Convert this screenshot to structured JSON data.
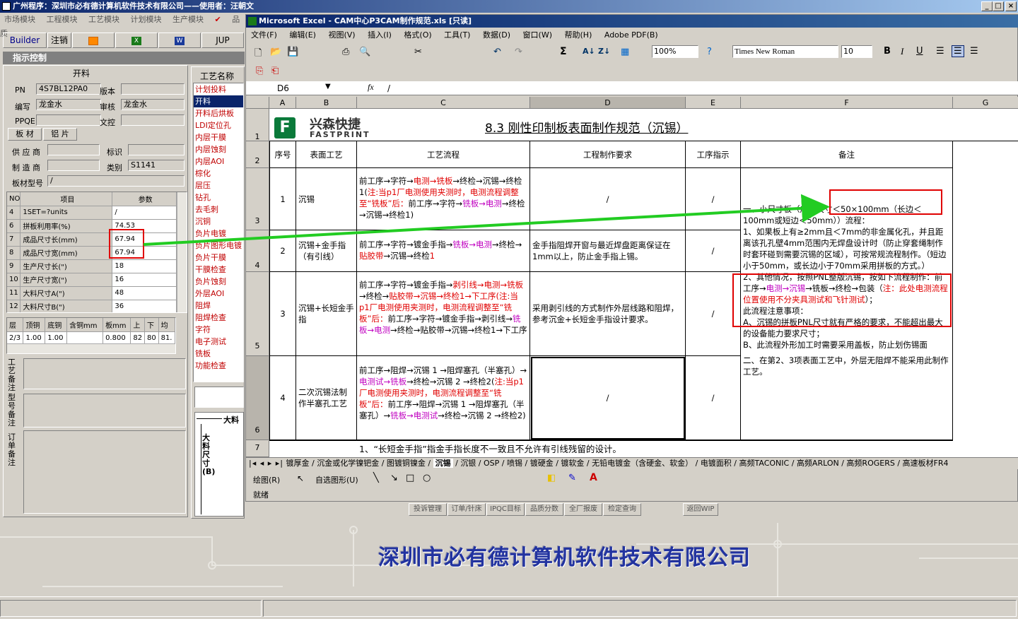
{
  "app": {
    "title": "广州程序：深圳市必有德计算机软件技术有限公司——使用者：汪朝文",
    "menu": [
      "市场模块",
      "工程模块",
      "工艺模块",
      "计划模块",
      "生产模块",
      "品质"
    ],
    "toolbar": {
      "builder": "Builder",
      "cancel": "注销",
      "jup": "JUP"
    },
    "panel_title": "指示控制",
    "group_title": "开料",
    "pn_label": "PN",
    "pn_value": "4S7BL12PA0",
    "version_label": "版本",
    "editor_label": "编写",
    "editor_value": "龙金水",
    "reviewer_label": "审核",
    "reviewer_value": "龙金水",
    "ppqe_label": "PPQE",
    "control_label": "文控",
    "tab_sheet": "板 材",
    "tab_copper": "铝 片",
    "supplier_label": "供 应 商",
    "mark_label": "标识",
    "maker_label": "制 造 商",
    "category_label": "类别",
    "category_value": "S1141",
    "model_label": "板材型号",
    "model_value": "/",
    "grid_head": [
      "NO",
      "项目",
      "参数"
    ],
    "grid_rows": [
      [
        "4",
        "1SET=?units",
        "/"
      ],
      [
        "6",
        "拼板利用率(%)",
        "74.53"
      ],
      [
        "7",
        "成品尺寸长(mm)",
        "67.94"
      ],
      [
        "8",
        "成品尺寸宽(mm)",
        "67.94"
      ],
      [
        "9",
        "生产尺寸长(\")",
        "18"
      ],
      [
        "10",
        "生产尺寸宽(\")",
        "16"
      ],
      [
        "11",
        "大料尺寸A(\")",
        "48"
      ],
      [
        "12",
        "大料尺寸B(\")",
        "36"
      ]
    ],
    "layer_head": [
      "层",
      "顶铜",
      "底铜",
      "含铜mm",
      "板mm",
      "上",
      "下",
      "均"
    ],
    "layer_row": [
      "2/3",
      "1.00",
      "1.00",
      "",
      "0.800",
      "82",
      "80",
      "81."
    ],
    "note_labels": [
      "工艺备注",
      "型号备注",
      "订单备注"
    ],
    "process_title": "工艺名称",
    "process_list": [
      "计划投料",
      "开料",
      "开料后烘板",
      "LDI定位孔",
      "内层干膜",
      "内层蚀刻",
      "内层AOI",
      "棕化",
      "层压",
      "钻孔",
      "去毛刺",
      "沉铜",
      "负片电镀",
      "负片图形电镀",
      "负片干膜",
      "干膜检查",
      "负片蚀刻",
      "外层AOI",
      "阻焊",
      "阻焊检查",
      "字符",
      "电子测试",
      "铣板",
      "功能检查"
    ],
    "dim_big": "大料",
    "dim_size": "大料尺寸(B)",
    "bottom_btns": [
      "投诉管理",
      "订单/针床",
      "IPQC目标",
      "品质分数",
      "全厂报废",
      "检定查询",
      "返回WIP"
    ],
    "footer": "深圳市必有德计算机软件技术有限公司"
  },
  "excel": {
    "title": "Microsoft Excel - CAM中心P3CAM制作规范.xls [只读]",
    "menu": [
      "文件(F)",
      "编辑(E)",
      "视图(V)",
      "插入(I)",
      "格式(O)",
      "工具(T)",
      "数据(D)",
      "窗口(W)",
      "帮助(H)",
      "Adobe PDF(B)"
    ],
    "zoom": "100%",
    "font": "Times New Roman",
    "font_size": "10",
    "name_box": "D6",
    "formula": "/",
    "columns": [
      "A",
      "B",
      "C",
      "D",
      "E",
      "F",
      "G"
    ],
    "logo_cn": "兴森快捷",
    "logo_en": "FASTPRINT",
    "doc_title": "8.3 刚性印制板表面制作规范（沉锡）",
    "headers": [
      "序号",
      "表面工艺",
      "工艺流程",
      "工程制作要求",
      "工序指示",
      "备注"
    ],
    "rows": [
      {
        "no": "1",
        "process": "沉锡",
        "req": "/",
        "step": "/"
      },
      {
        "no": "2",
        "process": "沉锡+金手指（有引线）",
        "req": "金手指阻焊开窗与最近焊盘距离保证在1mm以上，防止金手指上锡。",
        "step": "/"
      },
      {
        "no": "3",
        "process": "沉锡+长短金手指",
        "req": "采用剥引线的方式制作外层线路和阻焊，参考沉金+长短金手指设计要求。",
        "step": "/"
      },
      {
        "no": "4",
        "process": "二次沉锡法制作半塞孔工艺",
        "req": "/",
        "step": "/"
      }
    ],
    "flow1": [
      [
        "前工序→字符→",
        "k"
      ],
      [
        "电测→铣板",
        "r"
      ],
      [
        "→终检→沉锡→终检1(",
        "k"
      ],
      [
        "注:当p1厂电测使用夹测时，电测流程调整至“铣板”后：",
        "r"
      ],
      [
        "前工序→字符→",
        "k"
      ],
      [
        "铣板→电测",
        "m"
      ],
      [
        "→终检→沉锡→终检1)",
        "k"
      ]
    ],
    "flow2": [
      [
        "前工序→字符→镀金手指→",
        "k"
      ],
      [
        "铣板→电测",
        "m"
      ],
      [
        "→终检→",
        "k"
      ],
      [
        "贴胶带",
        "r"
      ],
      [
        "→沉锡→终检",
        "k"
      ],
      [
        "1",
        "r"
      ]
    ],
    "flow3": [
      [
        "前工序→字符→镀金手指→",
        "k"
      ],
      [
        "剥引线→电测→铣板",
        "r"
      ],
      [
        "→终检→",
        "k"
      ],
      [
        "贴胶带",
        "r"
      ],
      [
        "→沉锡→终检1→下工序(注:当p1厂电测使用夹测时，电测流程调整至“铣板”后：",
        "r"
      ],
      [
        "前工序→字符→镀金手指→剥引线→",
        "k"
      ],
      [
        "铣板→电测",
        "m"
      ],
      [
        "→终检→贴胶带→沉锡→终检1→下工序",
        "k"
      ]
    ],
    "flow4": [
      [
        "前工序→阻焊→沉锡 1 →阻焊塞孔（半塞孔）→",
        "k"
      ],
      [
        "电测试→铣板",
        "m"
      ],
      [
        "→终检→沉锡 2 →终检2(",
        "k"
      ],
      [
        "注:当p1厂电测使用夹测时，电测流程调整至“铣板”后：",
        "r"
      ],
      [
        "前工序→阻焊→沉锡 1 →阻焊塞孔（半塞孔）→",
        "k"
      ],
      [
        "铣板→电测试",
        "m"
      ],
      [
        "→终检→沉锡 2 →终检2)",
        "k"
      ]
    ],
    "remark1": "一、小尺寸板（成品尺寸＜50×100mm（长边＜100mm或短边＜50mm））流程：",
    "remark2": "1、如果板上有≥2mm且＜7mm的非金属化孔，并且距离该孔孔壁4mm范围内无焊盘设计时（防止穿套绳制作时套环碰到需要沉锡的区域），可按常规流程制作。（短边小于50mm，或长边小于70mm采用拼板的方式。）",
    "remark3": [
      [
        "2、其他情况，按照PNL整版沉锡，按如下流程制作：前工序→",
        "k"
      ],
      [
        "电测→沉锡",
        "m"
      ],
      [
        "→铣板→终检→包装（",
        "k"
      ],
      [
        "注：此处电测流程位置使用不分夹具测试和飞针测试",
        "r"
      ],
      [
        "）；",
        "k"
      ]
    ],
    "remark4": "此流程注意事项：",
    "remark5": "A、沉锡的拼板PNL尺寸就有严格的要求，不能超出最大的设备能力要求尺寸；",
    "remark6": "B、此流程外形加工时需要采用盖板，防止划伤锡面",
    "remark7": "二、在第2、3项表面工艺中，外层无阻焊不能采用此制作工艺。",
    "row7": "1、“长短金手指”指金手指长度不一致且不允许有引线残留的设计。",
    "sheet_tabs": [
      "镀厚金",
      "沉金或化学镍钯金",
      "图镀铜镍金",
      "沉锡",
      "沉银",
      "OSP",
      "喷锡",
      "镀硬金",
      "镀软金",
      "无铅电镀金（含硬金、软金）",
      "电镀面积",
      "高频TACONIC",
      "高频ARLON",
      "高频ROGERS",
      "高速板材FR4"
    ],
    "draw_label": "绘图(R)",
    "autoshape": "自选图形(U)",
    "status": "就绪"
  },
  "colors": {
    "title_bar": "#0a246a",
    "red": "#e00000",
    "magenta": "#c000c0",
    "arrow": "#22cc22"
  }
}
